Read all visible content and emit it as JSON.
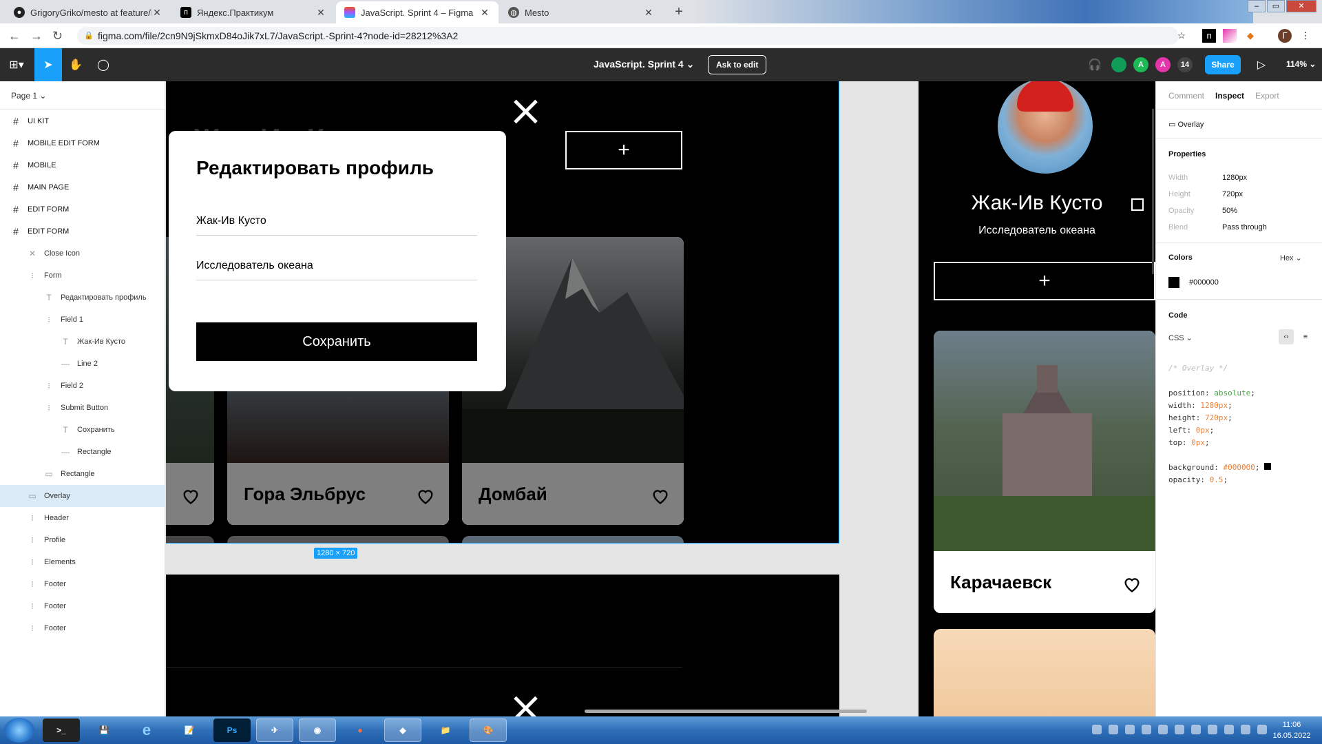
{
  "browser": {
    "tabs": [
      {
        "title": "GrigoryGriko/mesto at feature/he",
        "icon": "github-icon"
      },
      {
        "title": "Яндекс.Практикум",
        "icon": "practicum-icon"
      },
      {
        "title": "JavaScript. Sprint 4 – Figma",
        "icon": "figma-icon"
      },
      {
        "title": "Mesto",
        "icon": "globe-icon"
      }
    ],
    "active_tab": 2,
    "url": "figma.com/file/2cn9N9jSkmxD84oJik7xL7/JavaScript.-Sprint-4?node-id=28212%3A2",
    "profile_initial": "Г"
  },
  "figma": {
    "file_title": "JavaScript. Sprint 4",
    "ask_to_edit": "Ask to edit",
    "share": "Share",
    "zoom": "114%",
    "avatars": [
      {
        "label": "",
        "color": "#0f9d58"
      },
      {
        "label": "A",
        "color": "#1db954"
      },
      {
        "label": "A",
        "color": "#e535ab"
      },
      {
        "label": "14",
        "color": "#444444"
      }
    ]
  },
  "layers": {
    "page": "Page 1",
    "items": [
      {
        "name": "UI KIT",
        "type": "frame",
        "depth": 0
      },
      {
        "name": "MOBILE EDIT FORM",
        "type": "frame",
        "depth": 0
      },
      {
        "name": "MOBILE",
        "type": "frame",
        "depth": 0
      },
      {
        "name": "MAIN PAGE",
        "type": "frame",
        "depth": 0
      },
      {
        "name": "EDIT FORM",
        "type": "frame",
        "depth": 0
      },
      {
        "name": "EDIT FORM",
        "type": "frame",
        "depth": 0
      },
      {
        "name": "Close Icon",
        "type": "component",
        "depth": 1
      },
      {
        "name": "Form",
        "type": "group",
        "depth": 1
      },
      {
        "name": "Редактировать профиль",
        "type": "text",
        "depth": 2
      },
      {
        "name": "Field 1",
        "type": "group",
        "depth": 2
      },
      {
        "name": "Жак-Ив Кусто",
        "type": "text",
        "depth": 3
      },
      {
        "name": "Line 2",
        "type": "line",
        "depth": 3
      },
      {
        "name": "Field 2",
        "type": "group",
        "depth": 2
      },
      {
        "name": "Submit Button",
        "type": "group",
        "depth": 2
      },
      {
        "name": "Сохранить",
        "type": "text",
        "depth": 3
      },
      {
        "name": "Rectangle",
        "type": "line",
        "depth": 3
      },
      {
        "name": "Rectangle",
        "type": "rect",
        "depth": 2
      },
      {
        "name": "Overlay",
        "type": "rect",
        "depth": 1,
        "selected": true
      },
      {
        "name": "Header",
        "type": "group",
        "depth": 1
      },
      {
        "name": "Profile",
        "type": "group",
        "depth": 1
      },
      {
        "name": "Elements",
        "type": "group",
        "depth": 1
      },
      {
        "name": "Footer",
        "type": "group",
        "depth": 1
      },
      {
        "name": "Footer",
        "type": "group",
        "depth": 1
      },
      {
        "name": "Footer",
        "type": "group",
        "depth": 1
      }
    ]
  },
  "canvas": {
    "size_badge": "1280 × 720",
    "ghost_text": "Жак-Ив Кусто",
    "popup": {
      "title": "Редактировать профиль",
      "name_value": "Жак-Ив Кусто",
      "job_value": "Исследователь океана",
      "save_label": "Сохранить"
    },
    "cards": [
      {
        "title": "Гора Эльбрус"
      },
      {
        "title": "Домбай"
      }
    ],
    "mobile": {
      "name": "Жак-Ив Кусто",
      "job": "Исследователь океана",
      "card_title": "Карачаевск"
    },
    "help": "?"
  },
  "inspect": {
    "tabs": [
      "Comment",
      "Inspect",
      "Export"
    ],
    "active_tab": 1,
    "layer_name": "Overlay",
    "properties_label": "Properties",
    "props": [
      {
        "key": "Width",
        "value": "1280px"
      },
      {
        "key": "Height",
        "value": "720px"
      },
      {
        "key": "Opacity",
        "value": "50%"
      },
      {
        "key": "Blend",
        "value": "Pass through"
      }
    ],
    "colors_label": "Colors",
    "color_format": "Hex",
    "color_value": "#000000",
    "code_label": "Code",
    "code_lang": "CSS",
    "code": {
      "comment": "/* Overlay */",
      "lines": [
        {
          "prop": "position:",
          "val": "absolute",
          "kind": "g"
        },
        {
          "prop": "width:",
          "val": "1280px",
          "kind": "o"
        },
        {
          "prop": "height:",
          "val": "720px",
          "kind": "o"
        },
        {
          "prop": "left:",
          "val": "0px",
          "kind": "o"
        },
        {
          "prop": "top:",
          "val": "0px",
          "kind": "o"
        }
      ],
      "bg_prop": "background:",
      "bg_val": "#000000",
      "op_prop": "opacity:",
      "op_val": "0.5"
    }
  },
  "taskbar": {
    "apps": [
      "cmd",
      "save",
      "ie",
      "notepad",
      "Ps",
      "telegram",
      "chrome",
      "firefox",
      "app",
      "explorer",
      "paint"
    ],
    "time": "11:06",
    "date": "16.05.2022"
  }
}
